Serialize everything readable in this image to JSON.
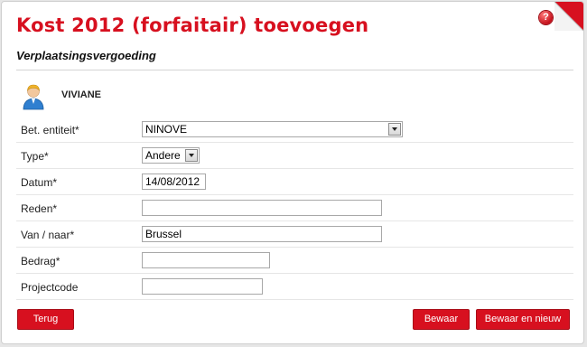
{
  "header": {
    "title": "Kost 2012 (forfaitair) toevoegen",
    "help_glyph": "?",
    "subtitle": "Verplaatsingsvergoeding"
  },
  "user": {
    "name": "VIVIANE",
    "icon": "user-avatar-icon"
  },
  "form": {
    "entity_label": "Bet. entiteit*",
    "entity_value": "NINOVE",
    "type_label": "Type*",
    "type_value": "Andere",
    "date_label": "Datum*",
    "date_value": "14/08/2012",
    "reason_label": "Reden*",
    "reason_value": "",
    "fromto_label": "Van / naar*",
    "fromto_value": "Brussel",
    "amount_label": "Bedrag*",
    "amount_value": "",
    "project_label": "Projectcode",
    "project_value": ""
  },
  "actions": {
    "back_label": "Terug",
    "save_label": "Bewaar",
    "save_new_label": "Bewaar en nieuw"
  },
  "colors": {
    "accent": "#d7101f",
    "page_bg": "#e6e6e6",
    "panel_bg": "#ffffff"
  }
}
